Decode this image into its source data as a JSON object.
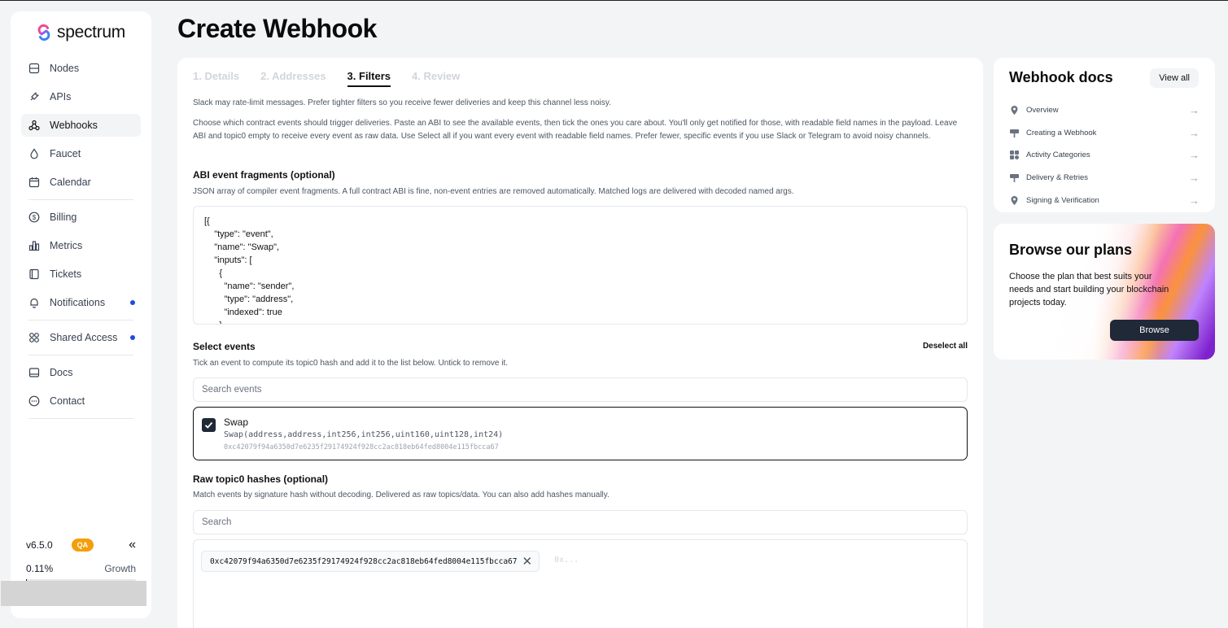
{
  "brand": {
    "name": "spectrum"
  },
  "sidebar": {
    "items": [
      {
        "label": "Nodes",
        "icon": "server-icon"
      },
      {
        "label": "APIs",
        "icon": "plug-icon"
      },
      {
        "label": "Webhooks",
        "icon": "webhook-icon",
        "active": true
      },
      {
        "label": "Faucet",
        "icon": "droplet-icon"
      },
      {
        "label": "Calendar",
        "icon": "calendar-icon"
      },
      {
        "label": "Billing",
        "icon": "dollar-icon"
      },
      {
        "label": "Metrics",
        "icon": "bar-chart-icon"
      },
      {
        "label": "Tickets",
        "icon": "ticket-icon"
      },
      {
        "label": "Notifications",
        "icon": "bell-icon",
        "dot": true
      },
      {
        "label": "Shared Access",
        "icon": "grid-icon",
        "dot": true
      },
      {
        "label": "Docs",
        "icon": "book-icon"
      },
      {
        "label": "Contact",
        "icon": "chat-icon"
      }
    ],
    "version": "v6.5.0",
    "env_badge": "QA",
    "collapse_glyph": "«",
    "usage_percent": "0.11%",
    "usage_fraction": 0.0011,
    "plan": "Growth"
  },
  "page": {
    "title": "Create Webhook"
  },
  "wizard": {
    "tabs": [
      "1. Details",
      "2. Addresses",
      "3. Filters",
      "4. Review"
    ],
    "active_tab": 2,
    "slack_note": "Slack may rate-limit messages. Prefer tighter filters so you receive fewer deliveries and keep this channel less noisy.",
    "intro": "Choose which contract events should trigger deliveries. Paste an ABI to see the available events, then tick the ones you care about. You'll only get notified for those, with readable field names in the payload. Leave ABI and topic0 empty to receive every event as raw data. Use Select all if you want every event with readable field names. Prefer fewer, specific events if you use Slack or Telegram to avoid noisy channels.",
    "abi": {
      "title": "ABI event fragments (optional)",
      "help": "JSON array of compiler event fragments. A full contract ABI is fine, non-event entries are removed automatically. Matched logs are delivered with decoded named args.",
      "code": "[{\n    \"type\": \"event\",\n    \"name\": \"Swap\",\n    \"inputs\": [\n      {\n        \"name\": \"sender\",\n        \"type\": \"address\",\n        \"indexed\": true\n      },\n      {"
    },
    "events": {
      "title": "Select events",
      "deselect_label": "Deselect all",
      "help": "Tick an event to compute its topic0 hash and add it to the list below. Untick to remove it.",
      "search_placeholder": "Search events",
      "items": [
        {
          "name": "Swap",
          "signature": "Swap(address,address,int256,int256,uint160,uint128,int24)",
          "hash": "0xc42079f94a6350d7e6235f29174924f928cc2ac818eb64fed8004e115fbcca67",
          "checked": true
        }
      ]
    },
    "topics": {
      "title": "Raw topic0 hashes (optional)",
      "help": "Match events by signature hash without decoding. Delivered as raw topics/data. You can also add hashes manually.",
      "search_placeholder": "Search",
      "chips": [
        "0xc42079f94a6350d7e6235f29174924f928cc2ac818eb64fed8004e115fbcca67"
      ],
      "input_placeholder": "0x..."
    }
  },
  "docs": {
    "title": "Webhook docs",
    "view_all": "View all",
    "items": [
      {
        "label": "Overview",
        "icon": "pin-icon"
      },
      {
        "label": "Creating a Webhook",
        "icon": "sign-icon"
      },
      {
        "label": "Activity Categories",
        "icon": "categories-icon"
      },
      {
        "label": "Delivery & Retries",
        "icon": "sign-icon"
      },
      {
        "label": "Signing & Verification",
        "icon": "pin-icon"
      }
    ]
  },
  "plans": {
    "title": "Browse our plans",
    "text": "Choose the plan that best suits your needs and start building your blockchain projects today.",
    "button": "Browse"
  },
  "colors": {
    "accent_dot": "#1d4ed8",
    "qa_badge": "#f59e0b",
    "dark_button": "#1f2937"
  }
}
